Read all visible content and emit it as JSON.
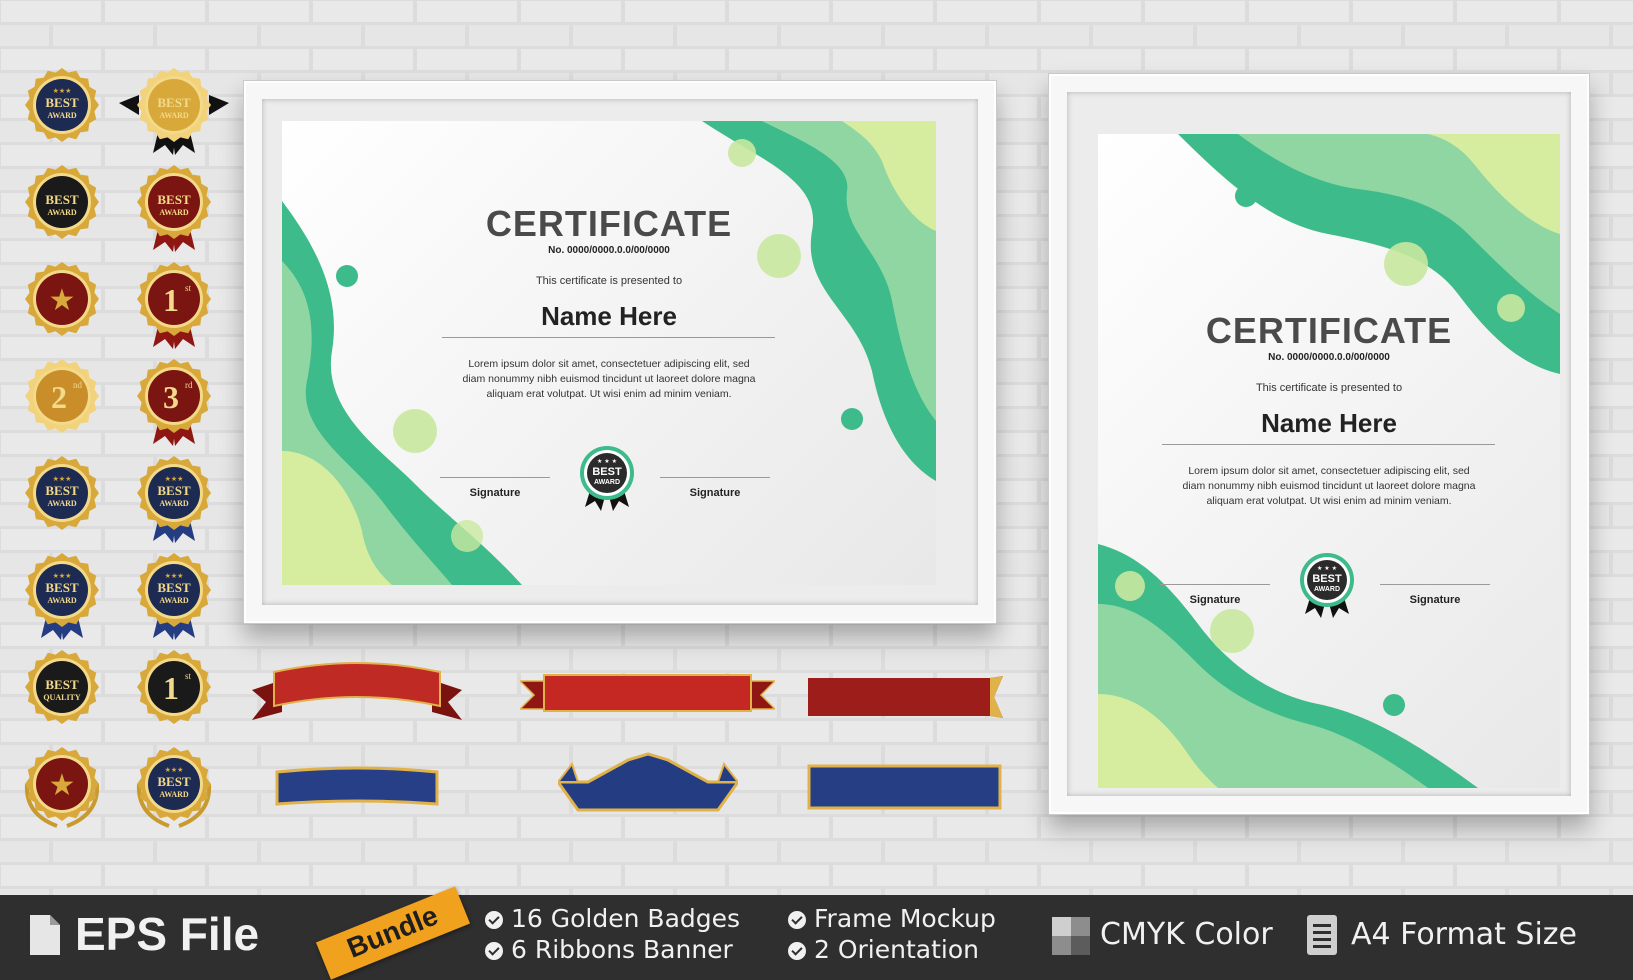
{
  "certificates": [
    {
      "title": "CERTIFICATE",
      "number": "No. 0000/0000.0.0/00/0000",
      "presented": "This certificate is presented to",
      "name": "Name Here",
      "body_line1": "Lorem ipsum dolor sit amet, consectetuer adipiscing elit, sed",
      "body_line2": "diam nonummy nibh euismod tincidunt ut laoreet dolore magna",
      "body_line3": "aliquam erat volutpat. Ut wisi enim ad minim veniam.",
      "signature_left": "Signature",
      "signature_right": "Signature",
      "seal_top": "BEST",
      "seal_bottom": "AWARD"
    },
    {
      "title": "CERTIFICATE",
      "number": "No. 0000/0000.0.0/00/0000",
      "presented": "This certificate is presented to",
      "name": "Name Here",
      "body_line1": "Lorem ipsum dolor sit amet, consectetuer adipiscing elit, sed",
      "body_line2": "diam nonummy nibh euismod tincidunt ut laoreet dolore magna",
      "body_line3": "aliquam erat volutpat. Ut wisi enim ad minim veniam.",
      "signature_left": "Signature",
      "signature_right": "Signature",
      "seal_top": "BEST",
      "seal_bottom": "AWARD"
    }
  ],
  "badges": [
    {
      "top": "BEST",
      "bottom": "AWARD",
      "style": "navy-gold"
    },
    {
      "top": "BEST",
      "bottom": "AWARD",
      "style": "gold-ribbon"
    },
    {
      "top": "BEST",
      "bottom": "AWARD",
      "style": "black-gold"
    },
    {
      "top": "BEST",
      "bottom": "AWARD",
      "style": "red-gold"
    },
    {
      "top": "",
      "bottom": "",
      "style": "star-red"
    },
    {
      "top": "1",
      "bottom": "st",
      "style": "first-red"
    },
    {
      "top": "2",
      "bottom": "nd",
      "style": "second-gold"
    },
    {
      "top": "3",
      "bottom": "rd",
      "style": "third-red"
    },
    {
      "top": "BEST",
      "bottom": "AWARD",
      "style": "navy-stars"
    },
    {
      "top": "BEST",
      "bottom": "AWARD",
      "style": "navy-stars-ribbon"
    },
    {
      "top": "BEST",
      "bottom": "AWARD",
      "style": "navy-ribbon"
    },
    {
      "top": "BEST",
      "bottom": "AWARD",
      "style": "navy-ribbon-2"
    },
    {
      "top": "BEST",
      "bottom": "QUALITY",
      "style": "black-quality"
    },
    {
      "top": "1",
      "bottom": "st",
      "style": "first-black"
    },
    {
      "top": "",
      "bottom": "",
      "style": "star-laurel"
    },
    {
      "top": "BEST",
      "bottom": "AWARD",
      "style": "navy-laurel"
    }
  ],
  "colors": {
    "green_dark": "#3dbb8a",
    "green_light": "#c8e8a0",
    "gold": "#d8a93a",
    "red": "#b4221f",
    "navy": "#1f3466",
    "footer_bg": "#2f2f2f",
    "bundle_tag": "#f0a11d"
  },
  "footer": {
    "file_icon": "document-icon",
    "file_label": "EPS File",
    "bundle_label": "Bundle",
    "feature1": "16 Golden Badges",
    "feature2": "6  Ribbons Banner",
    "feature3": "Frame Mockup",
    "feature4": "2 Orientation",
    "color_label": "CMYK Color",
    "format_label": "A4 Format Size"
  }
}
